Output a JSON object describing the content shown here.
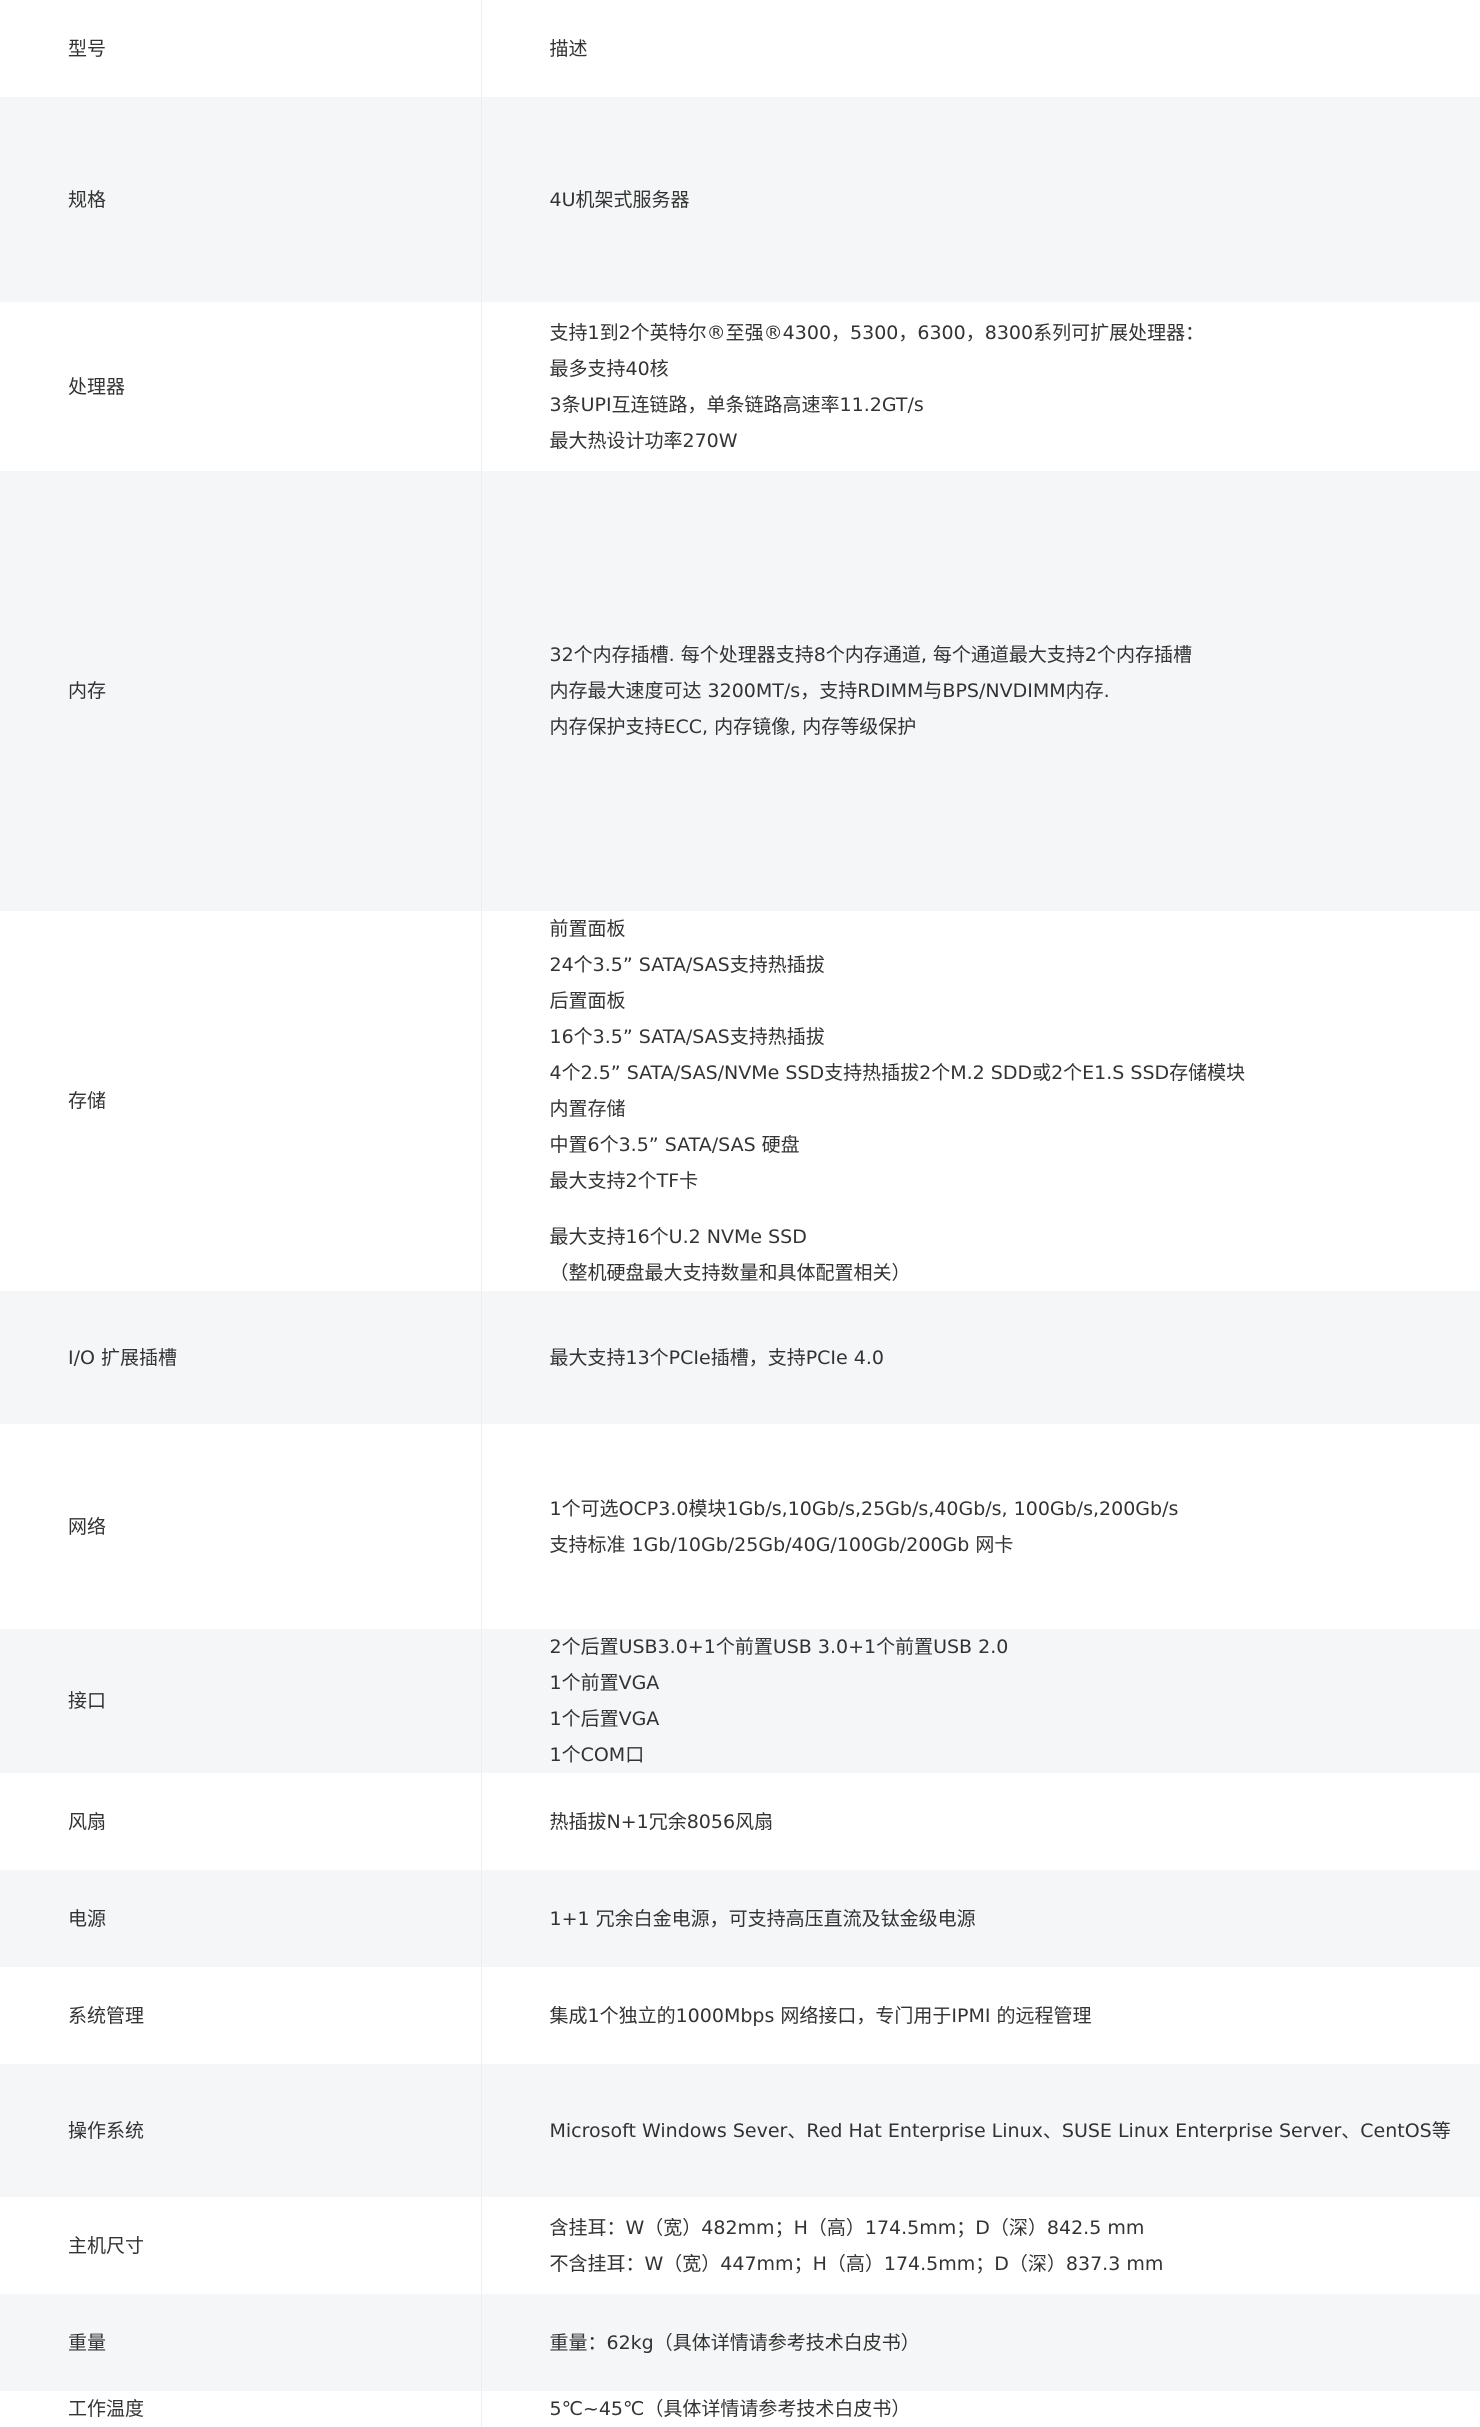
{
  "header": {
    "key": "型号",
    "value": "描述"
  },
  "rows": [
    {
      "key": "规格",
      "lines": [
        "4U机架式服务器"
      ]
    },
    {
      "key": "处理器",
      "lines": [
        "支持1到2个英特尔®至强®4300，5300，6300，8300系列可扩展处理器：",
        "最多支持40核",
        "3条UPI互连链路，单条链路高速率11.2GT/s",
        "最大热设计功率270W"
      ]
    },
    {
      "key": "内存",
      "lines": [
        "32个内存插槽. 每个处理器支持8个内存通道, 每个通道最大支持2个内存插槽",
        "内存最大速度可达 3200MT/s，支持RDIMM与BPS/NVDIMM内存.",
        "内存保护支持ECC, 内存镜像, 内存等级保护"
      ]
    },
    {
      "key": "存储",
      "lines": [
        "前置面板",
        "24个3.5”  SATA/SAS支持热插拔",
        "后置面板",
        "16个3.5”  SATA/SAS支持热插拔",
        "4个2.5”  SATA/SAS/NVMe SSD支持热插拔2个M.2 SDD或2个E1.S SSD存储模块",
        "内置存储",
        "中置6个3.5”  SATA/SAS 硬盘",
        "最大支持2个TF卡"
      ],
      "extra_lines": [
        "最大支持16个U.2 NVMe SSD",
        "（整机硬盘最大支持数量和具体配置相关）"
      ]
    },
    {
      "key": "I/O 扩展插槽",
      "lines": [
        "最大支持13个PCIe插槽，支持PCIe 4.0"
      ]
    },
    {
      "key": "网络",
      "lines": [
        "1个可选OCP3.0模块1Gb/s,10Gb/s,25Gb/s,40Gb/s, 100Gb/s,200Gb/s",
        "支持标准 1Gb/10Gb/25Gb/40G/100Gb/200Gb 网卡"
      ]
    },
    {
      "key": "接口",
      "lines": [
        "2个后置USB3.0+1个前置USB 3.0+1个前置USB 2.0",
        "1个前置VGA",
        "1个后置VGA",
        "1个COM口"
      ]
    },
    {
      "key": "风扇",
      "lines": [
        "热插拔N+1冗余8056风扇"
      ]
    },
    {
      "key": "电源",
      "lines": [
        "1+1 冗余白金电源，可支持高压直流及钛金级电源"
      ]
    },
    {
      "key": "系统管理",
      "lines": [
        "集成1个独立的1000Mbps 网络接口，专门用于IPMI 的远程管理"
      ]
    },
    {
      "key": "操作系统",
      "lines": [
        "Microsoft Windows Sever、Red Hat Enterprise Linux、SUSE Linux Enterprise Server、CentOS等"
      ]
    },
    {
      "key": "主机尺寸",
      "lines": [
        "含挂耳：W（宽）482mm；H（高）174.5mm；D（深）842.5 mm",
        "不含挂耳：W（宽）447mm；H（高）174.5mm；D（深）837.3 mm"
      ]
    },
    {
      "key": "重量",
      "lines": [
        "重量：62kg（具体详情请参考技术白皮书）"
      ]
    },
    {
      "key": "工作温度",
      "lines": [
        "5℃~45℃（具体详情请参考技术白皮书）"
      ]
    }
  ]
}
